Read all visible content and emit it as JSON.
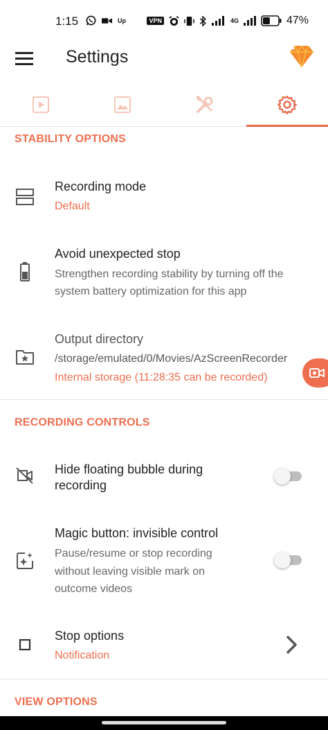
{
  "status_bar": {
    "time": "1:15",
    "vpn": "VPN",
    "network": "4G",
    "battery_pct": "47%",
    "battery_level": 0.47
  },
  "app_bar": {
    "title": "Settings",
    "menu_icon": "hamburger-icon",
    "premium_icon": "diamond-icon"
  },
  "tabs": [
    {
      "icon": "video-icon",
      "active": false
    },
    {
      "icon": "image-icon",
      "active": false
    },
    {
      "icon": "tools-icon",
      "active": false
    },
    {
      "icon": "gear-icon",
      "active": true
    }
  ],
  "sections": {
    "stability": {
      "header": "STABILITY OPTIONS",
      "items": [
        {
          "title": "Recording mode",
          "value": "Default",
          "icon": "recording-mode-icon"
        },
        {
          "title": "Avoid unexpected stop",
          "description_line1": "Strengthen recording stability by turning off the",
          "description_line2": "system battery optimization for this app",
          "icon": "battery-icon"
        },
        {
          "title": "Output directory",
          "path": "/storage/emulated/0/Movies/AzScreenRecorder",
          "value": "Internal storage (11:28:35 can be recorded)",
          "icon": "folder-star-icon"
        }
      ]
    },
    "recording_controls": {
      "header": "RECORDING CONTROLS",
      "items": [
        {
          "title_line1": "Hide floating bubble during",
          "title_line2": "recording",
          "toggle_on": false,
          "icon": "video-off-icon"
        },
        {
          "title": "Magic button: invisible control",
          "description_line1": "Pause/resume or stop recording",
          "description_line2": "without leaving visible mark on",
          "description_line3": "outcome videos",
          "toggle_on": false,
          "icon": "magic-sparkle-icon"
        },
        {
          "title": "Stop options",
          "value": "Notification",
          "icon": "stop-square-icon"
        }
      ]
    },
    "view": {
      "header": "VIEW OPTIONS"
    }
  },
  "colors": {
    "accent": "#ee6e4f",
    "tab_inactive": "#f6c6b8"
  }
}
